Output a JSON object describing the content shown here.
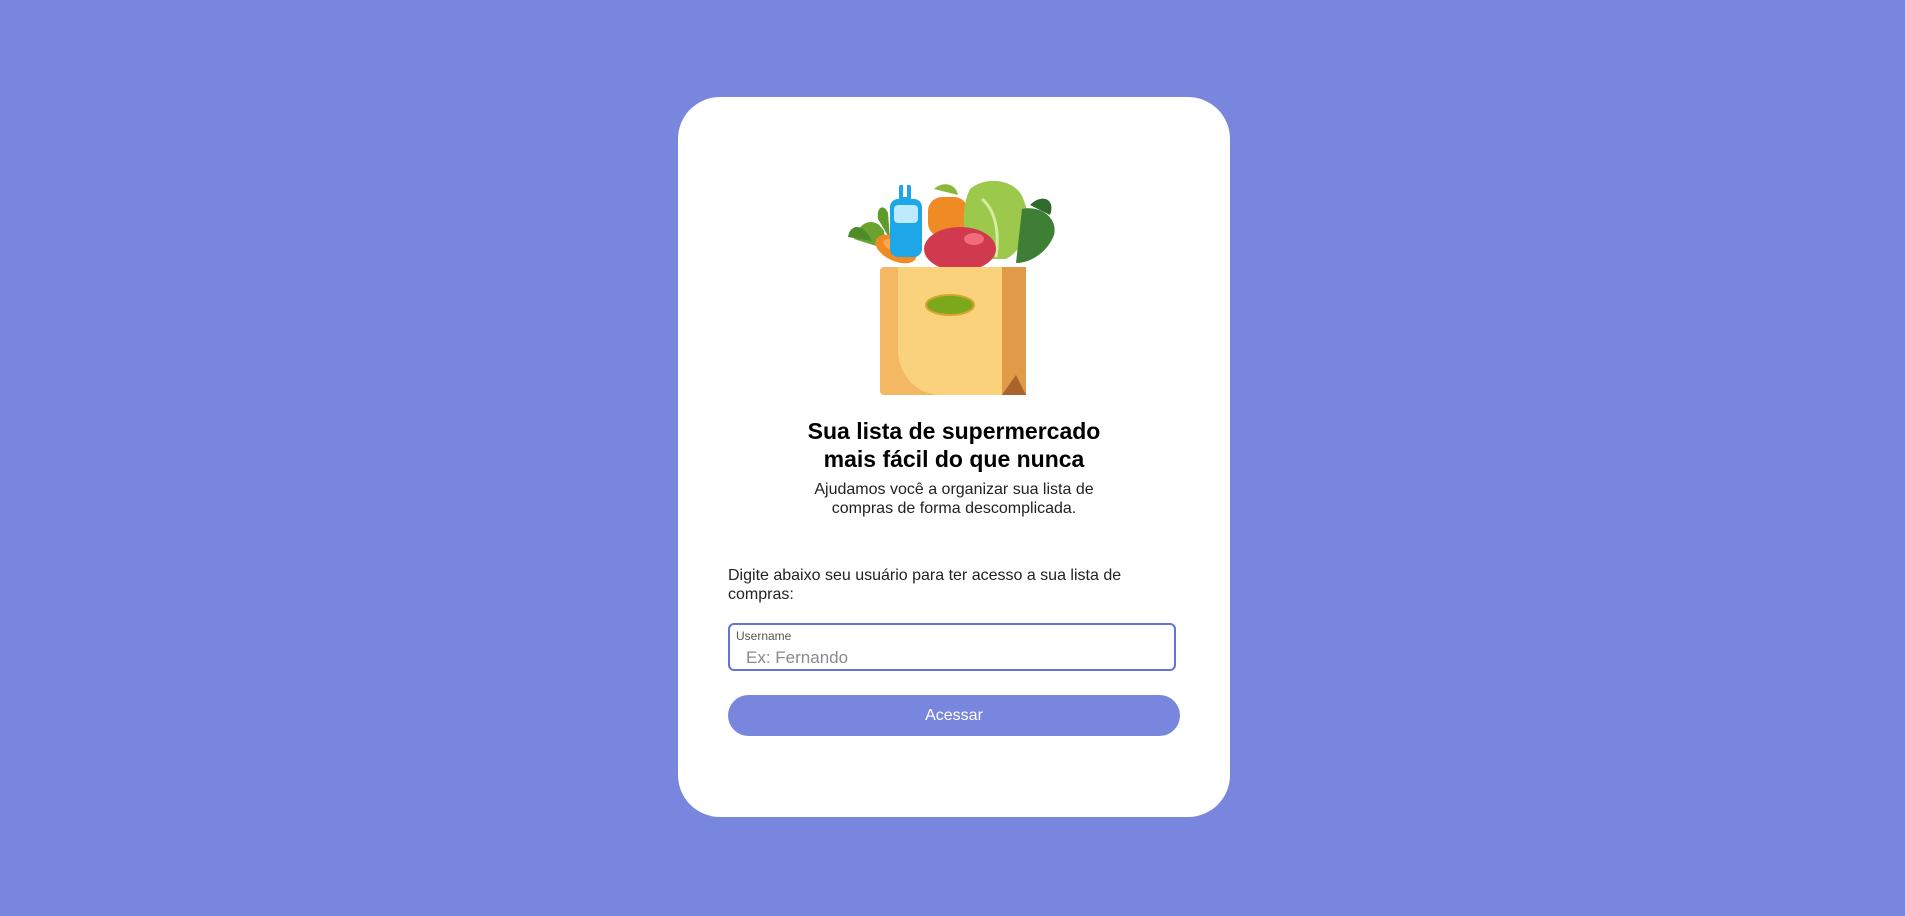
{
  "page": {
    "background_color": "#7986DD"
  },
  "hero": {
    "illustration_icon": "grocery-bag-icon",
    "headline_line1": "Sua lista de supermercado",
    "headline_line2": "mais fácil do que nunca",
    "subtitle": "Ajudamos você a organizar sua lista de compras de forma descomplicada."
  },
  "login": {
    "instruction": "Digite abaixo seu usuário para ter acesso a sua lista de compras:",
    "username_label": "Username",
    "username_placeholder": "Ex: Fernando",
    "username_value": "",
    "submit_label": "Acessar",
    "accent_color": "#7986DD"
  }
}
